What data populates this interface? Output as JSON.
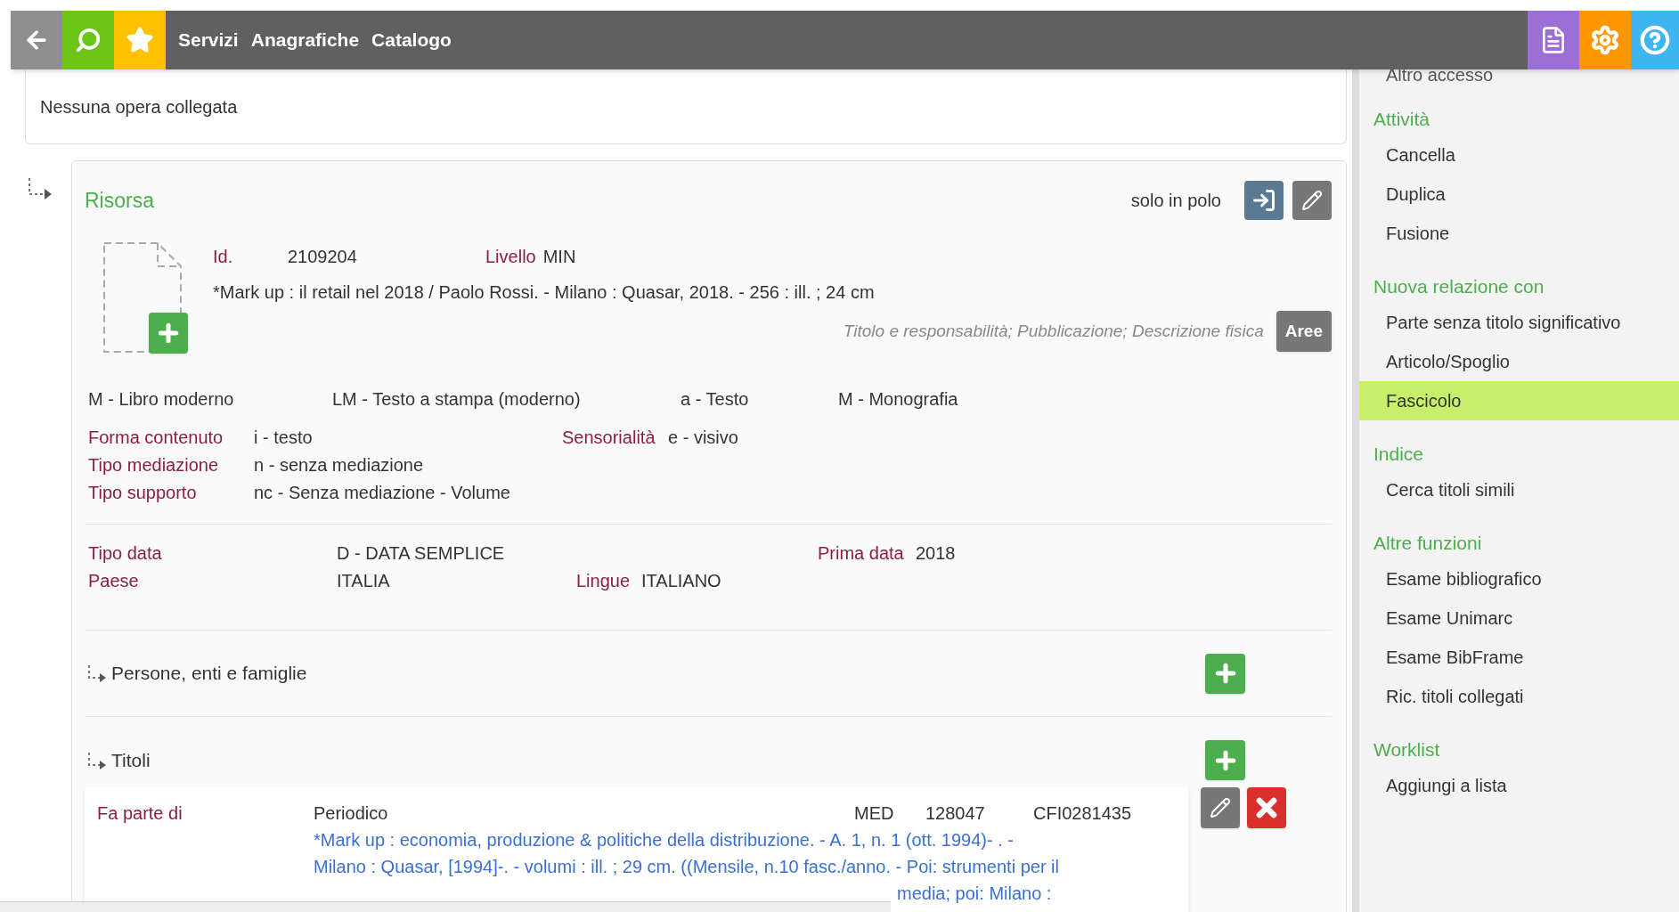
{
  "top_nav": {
    "menu": [
      "Servizi",
      "Anagrafiche",
      "Catalogo"
    ]
  },
  "linked_works": {
    "text": "Nessuna opera collegata"
  },
  "resource": {
    "title": "Risorsa",
    "scope": "solo in polo",
    "id_label": "Id.",
    "id": "2109204",
    "level_label": "Livello",
    "level": "MIN",
    "description": "*Mark up : il retail nel 2018 / Paolo Rossi. - Milano : Quasar, 2018. - 256 : ill. ; 24 cm",
    "areas_hint": "Titolo e responsabilità; Pubblicazione; Descrizione fisica",
    "areas_button": "Aree",
    "types": [
      "M - Libro moderno",
      "LM - Testo a stampa (moderno)",
      "a - Testo",
      "M - Monografia"
    ],
    "content_fields": [
      [
        {
          "label": "Forma contenuto",
          "value": "i - testo"
        },
        {
          "label": "Sensorialità",
          "value": "e - visivo"
        }
      ],
      [
        {
          "label": "Tipo mediazione",
          "value": "n - senza mediazione"
        }
      ],
      [
        {
          "label": "Tipo supporto",
          "value": "nc - Senza mediazione - Volume"
        }
      ]
    ],
    "date_fields": [
      [
        {
          "label": "Tipo data",
          "value": "D - DATA SEMPLICE"
        },
        {
          "label": "Prima data",
          "value": "2018"
        }
      ],
      [
        {
          "label": "Paese",
          "value": "ITALIA"
        },
        {
          "label": "Lingue",
          "value": "ITALIANO"
        }
      ]
    ],
    "sections": [
      {
        "title": "Persone, enti e famiglie"
      },
      {
        "title": "Titoli"
      }
    ],
    "link": {
      "label": "Fa parte di",
      "type": "Periodico",
      "level": "MED",
      "id": "128047",
      "code": "CFI0281435",
      "lines": [
        "*Mark up : economia, produzione & politiche della distribuzione. - A. 1, n. 1 (ott. 1994)- . -",
        "Milano : Quasar, [1994]-. - volumi : ill. ; 29 cm. ((Mensile, n.10 fasc./anno. - Poi: strumenti per il",
        "media; poi: Milano :"
      ]
    }
  },
  "sidebar": {
    "top_item": "Altro accesso",
    "groups": [
      {
        "title": "Attività",
        "items": [
          {
            "label": "Cancella",
            "selected": false
          },
          {
            "label": "Duplica",
            "selected": false
          },
          {
            "label": "Fusione",
            "selected": false
          }
        ]
      },
      {
        "title": "Nuova relazione con",
        "items": [
          {
            "label": "Parte senza titolo significativo",
            "selected": false
          },
          {
            "label": "Articolo/Spoglio",
            "selected": false
          },
          {
            "label": "Fascicolo",
            "selected": true
          }
        ]
      },
      {
        "title": "Indice",
        "items": [
          {
            "label": "Cerca titoli simili",
            "selected": false
          }
        ]
      },
      {
        "title": "Altre funzioni",
        "items": [
          {
            "label": "Esame bibliografico",
            "selected": false
          },
          {
            "label": "Esame Unimarc",
            "selected": false
          },
          {
            "label": "Esame BibFrame",
            "selected": false
          },
          {
            "label": "Ric. titoli collegati",
            "selected": false
          }
        ]
      },
      {
        "title": "Worklist",
        "items": [
          {
            "label": "Aggiungi a lista",
            "selected": false
          }
        ]
      }
    ]
  }
}
